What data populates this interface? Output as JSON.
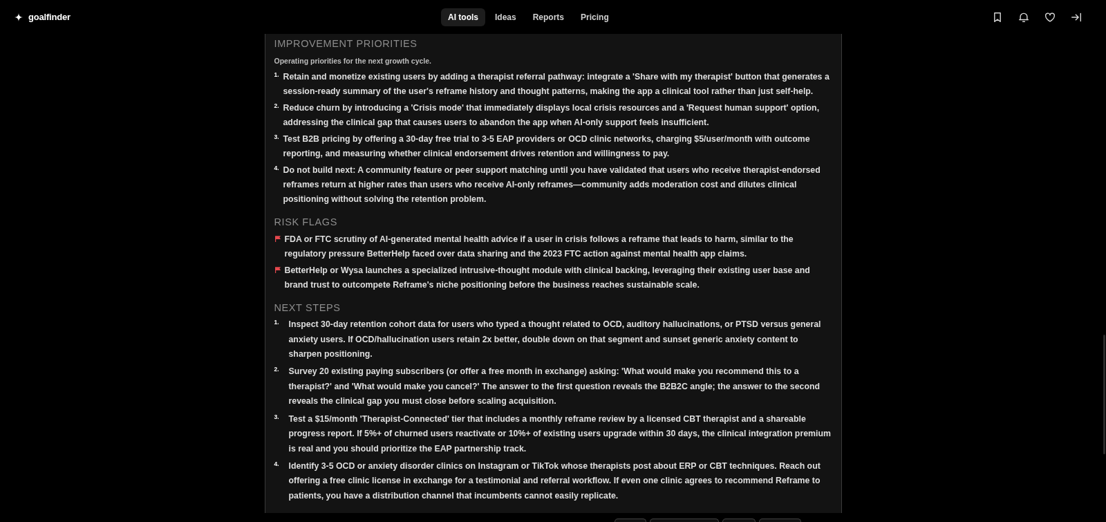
{
  "header": {
    "logo": "goalfinder",
    "nav": [
      {
        "label": "AI tools",
        "selected": true
      },
      {
        "label": "Ideas",
        "selected": false
      },
      {
        "label": "Reports",
        "selected": false
      },
      {
        "label": "Pricing",
        "selected": false
      }
    ]
  },
  "sections": [
    {
      "kind": "numbered",
      "title": "IMPROVEMENT PRIORITIES",
      "subtitle": "Operating priorities for the next growth cycle.",
      "items": [
        {
          "number": "1.",
          "text": "Retain and monetize existing users by adding a therapist referral pathway: integrate a 'Share with my therapist' button that generates a session-ready summary of the user's reframe history and thought patterns, making the app a clinical tool rather than just self-help."
        },
        {
          "number": "2.",
          "text": "Reduce churn by introducing a 'Crisis mode' that immediately displays local crisis resources and a 'Request human support' option, addressing the clinical gap that causes users to abandon the app when AI-only support feels insufficient."
        },
        {
          "number": "3.",
          "text": "Test B2B pricing by offering a 30-day free trial to 3-5 EAP providers or OCD clinic networks, charging $5/user/month with outcome reporting, and measuring whether clinical endorsement drives retention and willingness to pay."
        },
        {
          "number": "4.",
          "text": "Do not build next: A community feature or peer support matching until you have validated that users who receive therapist-endorsed reframes return at higher rates than users who receive AI-only reframes—community adds moderation cost and dilutes clinical positioning without solving the retention problem."
        }
      ]
    },
    {
      "kind": "flagged",
      "title": "RISK FLAGS",
      "items": [
        {
          "text": "FDA or FTC scrutiny of AI-generated mental health advice if a user in crisis follows a reframe that leads to harm, similar to the regulatory pressure BetterHelp faced over data sharing and the 2023 FTC action against mental health app claims."
        },
        {
          "text": "BetterHelp or Wysa launches a specialized intrusive-thought module with clinical backing, leveraging their existing user base and brand trust to outcompete Reframe's niche positioning before the business reaches sustainable scale."
        }
      ]
    },
    {
      "kind": "steps",
      "title": "NEXT STEPS",
      "items": [
        {
          "number": "1.",
          "text": "Inspect 30-day retention cohort data for users who typed a thought related to OCD, auditory hallucinations, or PTSD versus general anxiety users. If OCD/hallucination users retain 2x better, double down on that segment and sunset generic anxiety content to sharpen positioning."
        },
        {
          "number": "2.",
          "text": "Survey 20 existing paying subscribers (or offer a free month in exchange) asking: 'What would make you recommend this to a therapist?' and 'What would make you cancel?' The answer to the first question reveals the B2B2C angle; the answer to the second reveals the clinical gap you must close before scaling acquisition."
        },
        {
          "number": "3.",
          "text": "Test a $15/month 'Therapist-Connected' tier that includes a monthly reframe review by a licensed CBT therapist and a shareable progress report. If 5%+ of churned users reactivate or 10%+ of existing users upgrade within 30 days, the clinical integration premium is real and you should prioritize the EAP partnership track."
        },
        {
          "number": "4.",
          "text": "Identify 3-5 OCD or anxiety disorder clinics on Instagram or TikTok whose therapists post about ERP or CBT techniques. Reach out offering a free clinic license in exchange for a testimonial and referral workflow. If even one clinic agrees to recommend Reframe to patients, you have a distribution channel that incumbents cannot easily replicate."
        }
      ]
    }
  ]
}
